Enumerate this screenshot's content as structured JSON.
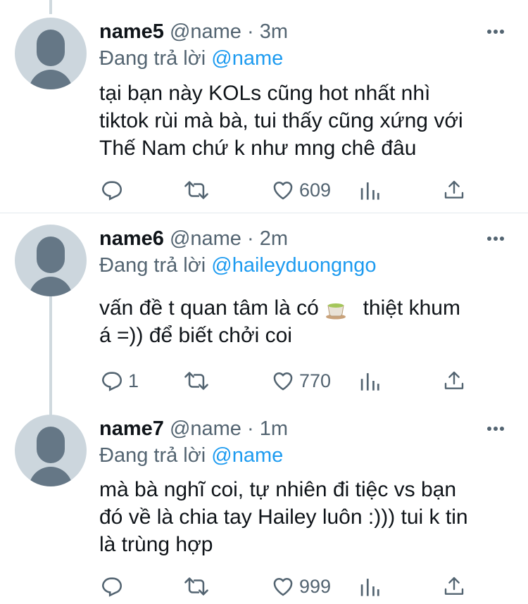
{
  "tweets": [
    {
      "name": "name5",
      "handle": "@name",
      "time": "· 3m",
      "reply_prefix": "Đang trả lời",
      "reply_to": "@name",
      "text_lines": [
        "tại bạn này KOLs cũng hot nhất nhì",
        "tiktok rùi mà bà, tui thấy cũng xứng với",
        "Thế Nam chứ k như mng chê đâu"
      ],
      "reply_count": "",
      "retweet_count": "",
      "like_count": "609"
    },
    {
      "name": "name6",
      "handle": "@name",
      "time": "· 2m",
      "reply_prefix": "Đang trả lời",
      "reply_to": "@haileyduongngo",
      "text_lines": [
        "vấn đề t quan tâm là có",
        "thiệt khum",
        "á =)) để biết chởi coi"
      ],
      "reply_count": "1",
      "retweet_count": "",
      "like_count": "770"
    },
    {
      "name": "name7",
      "handle": "@name",
      "time": "· 1m",
      "reply_prefix": "Đang trả lời",
      "reply_to": "@name",
      "text_lines": [
        "mà bà nghĩ coi, tự nhiên đi tiệc vs bạn",
        "đó về là chia tay Hailey luôn :))) tui k tin",
        "là trùng hợp"
      ],
      "reply_count": "",
      "retweet_count": "",
      "like_count": "999"
    }
  ],
  "icons": {
    "reply": "reply-icon",
    "retweet": "retweet-icon",
    "like": "heart-icon",
    "analytics": "analytics-icon",
    "share": "share-icon",
    "more": "more-icon",
    "tea": "tea-emoji-icon"
  },
  "colors": {
    "link": "#1d9bf0",
    "secondary": "#536471",
    "avatar_bg": "#ccd6dd",
    "avatar_fg": "#657786",
    "thread_line": "#cfd9de"
  }
}
